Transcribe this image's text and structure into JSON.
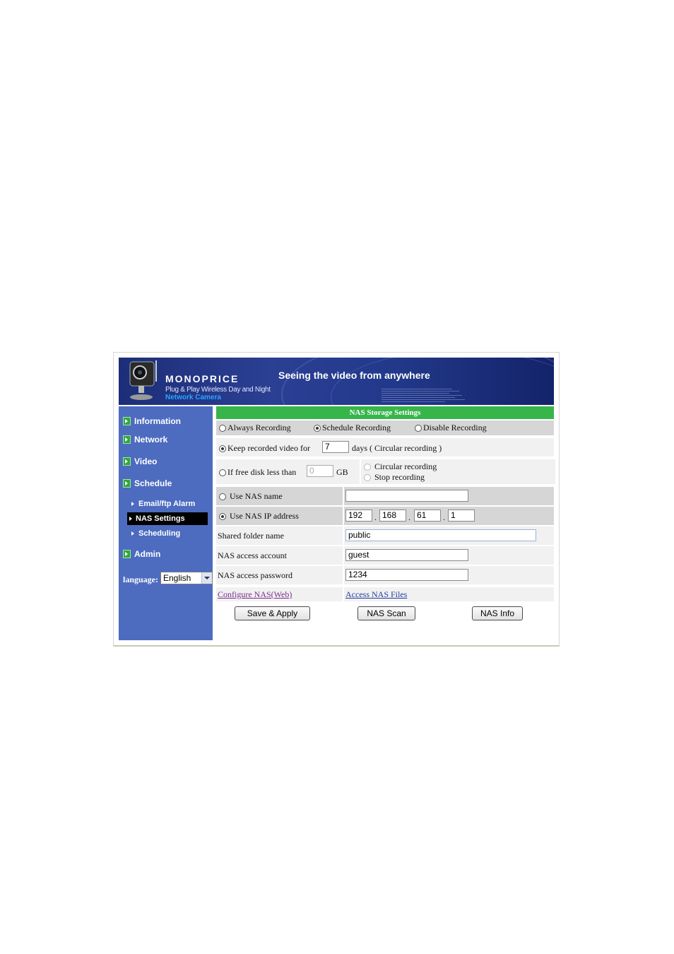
{
  "header": {
    "brand": "MONOPRICE",
    "brand_line1": "Plug & Play Wireless Day and Night",
    "brand_line2": "Network Camera",
    "tagline": "Seeing the video from anywhere"
  },
  "sidebar": {
    "items": [
      {
        "label": "Information"
      },
      {
        "label": "Network"
      },
      {
        "label": "Video"
      },
      {
        "label": "Schedule"
      },
      {
        "label": "Admin"
      }
    ],
    "sub_items": [
      {
        "label": "Email/ftp Alarm"
      },
      {
        "label": "NAS Settings"
      },
      {
        "label": "Scheduling"
      }
    ],
    "language_label": "language:",
    "language_value": "English"
  },
  "content": {
    "title": "NAS Storage Settings",
    "recording_modes": {
      "always": "Always Recording",
      "schedule": "Schedule Recording",
      "disable": "Disable Recording",
      "selected": "Schedule Recording"
    },
    "keep": {
      "label_before": "Keep recorded video for",
      "value": "7",
      "label_after": "days ( Circular recording )"
    },
    "free_disk": {
      "label": "If free disk less than",
      "value": "0",
      "unit": "GB",
      "option_circular": "Circular recording",
      "option_stop": "Stop recording"
    },
    "use_nas_name": {
      "label": "Use NAS name",
      "value": ""
    },
    "use_nas_ip": {
      "label": "Use NAS IP address",
      "octet1": "192",
      "octet2": "168",
      "octet3": "61",
      "octet4": "1",
      "dot": "."
    },
    "shared_folder": {
      "label": "Shared folder name",
      "value": "public"
    },
    "account": {
      "label": "NAS access account",
      "value": "guest"
    },
    "password": {
      "label": "NAS access password",
      "value": "1234"
    },
    "links": {
      "configure": "Configure NAS(Web)",
      "access": "Access NAS Files"
    },
    "buttons": {
      "save": "Save & Apply",
      "scan": "NAS Scan",
      "info": "NAS Info"
    }
  },
  "colors": {
    "sidebar_bg": "#4d6cc0",
    "title_bar": "#37b54a",
    "banner_bg": "#1d2e78"
  }
}
